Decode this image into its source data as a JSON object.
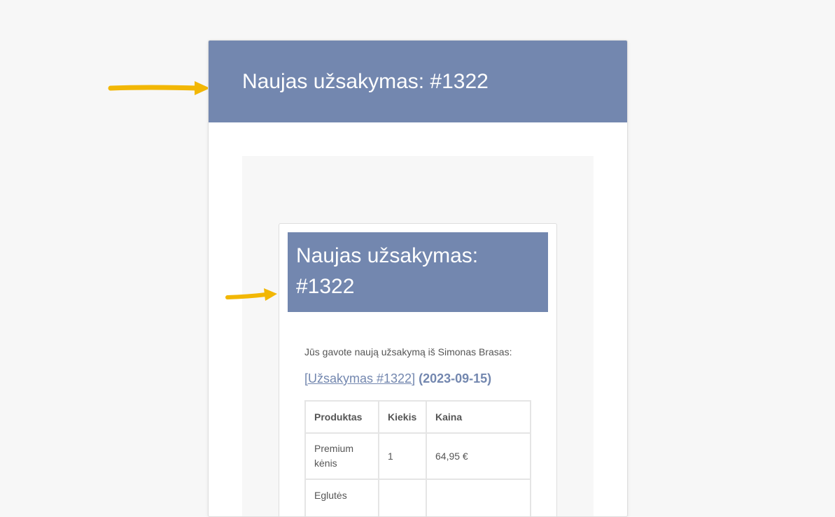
{
  "header": {
    "title": "Naujas užsakymas: #1322"
  },
  "preview": {
    "header_title": "Naujas užsakymas: #1322",
    "intro": "Jūs gavote naują užsakymą iš Simonas Brasas:",
    "order_link": "[Užsakymas #1322]",
    "order_date": "(2023-09-15)",
    "table": {
      "columns": [
        "Produktas",
        "Kiekis",
        "Kaina"
      ],
      "rows": [
        {
          "product": "Premium kėnis",
          "qty": "1",
          "price": "64,95 €"
        },
        {
          "product": "Eglutės",
          "qty": "",
          "price": ""
        }
      ]
    }
  },
  "colors": {
    "header_bg": "#7387af",
    "page_bg": "#f7f7f7",
    "arrow": "#f2b705"
  },
  "icons": {
    "arrow_top": "arrow-right-icon",
    "arrow_inner": "arrow-right-icon"
  }
}
